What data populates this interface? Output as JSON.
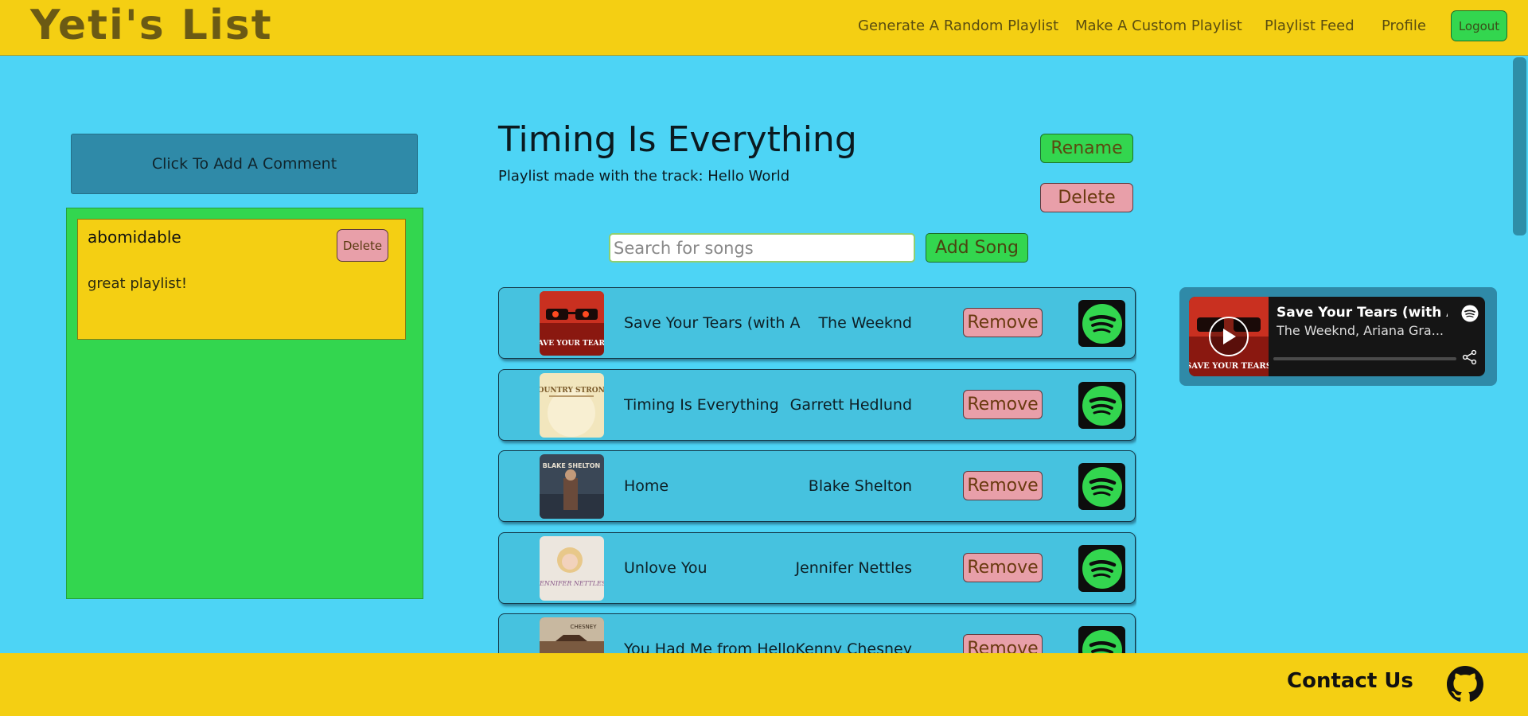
{
  "header": {
    "logo": "Yeti's List",
    "nav": [
      {
        "label": "Generate A Random Playlist"
      },
      {
        "label": "Make A Custom Playlist"
      },
      {
        "label": "Playlist Feed"
      },
      {
        "label": "Profile"
      }
    ],
    "logout_label": "Logout"
  },
  "comments": {
    "add_label": "Click To Add A Comment",
    "items": [
      {
        "user": "abomidable",
        "text": "great playlist!",
        "delete_label": "Delete"
      }
    ]
  },
  "playlist": {
    "title": "Timing Is Everything",
    "subtitle": "Playlist made with the track: Hello World",
    "rename_label": "Rename",
    "delete_label": "Delete",
    "search_placeholder": "Search for songs",
    "add_song_label": "Add Song",
    "remove_label": "Remove",
    "tracks": [
      {
        "name": "Save Your Tears (with A...",
        "artist": "The Weeknd",
        "art_color": "#b8261a",
        "art_text": "SAVE YOUR TEARS"
      },
      {
        "name": "Timing Is Everything",
        "artist": "Garrett Hedlund",
        "art_color": "#f1e3b4",
        "art_text": "COUNTRY STRONG"
      },
      {
        "name": "Home",
        "artist": "Blake Shelton",
        "art_color": "#3c4a5a",
        "art_text": "BLAKE SHELTON"
      },
      {
        "name": "Unlove You",
        "artist": "Jennifer Nettles",
        "art_color": "#e9e4dc",
        "art_text": "JENNIFER NETTLES"
      },
      {
        "name": "You Had Me from Hello",
        "artist": "Kenny Chesney",
        "art_color": "#6b4a34",
        "art_text": "CHESNEY"
      }
    ]
  },
  "player": {
    "title": "Save Your Tears (with A...",
    "artist": "The Weeknd, Ariana Gra...",
    "art_text": "SAVE YOUR TEARS"
  },
  "footer": {
    "contact_label": "Contact Us"
  },
  "colors": {
    "background": "#4dd4f5",
    "header": "#f4cf13",
    "green": "#33d64f",
    "pink": "#e89fa9",
    "teal": "#2f8aa8"
  }
}
